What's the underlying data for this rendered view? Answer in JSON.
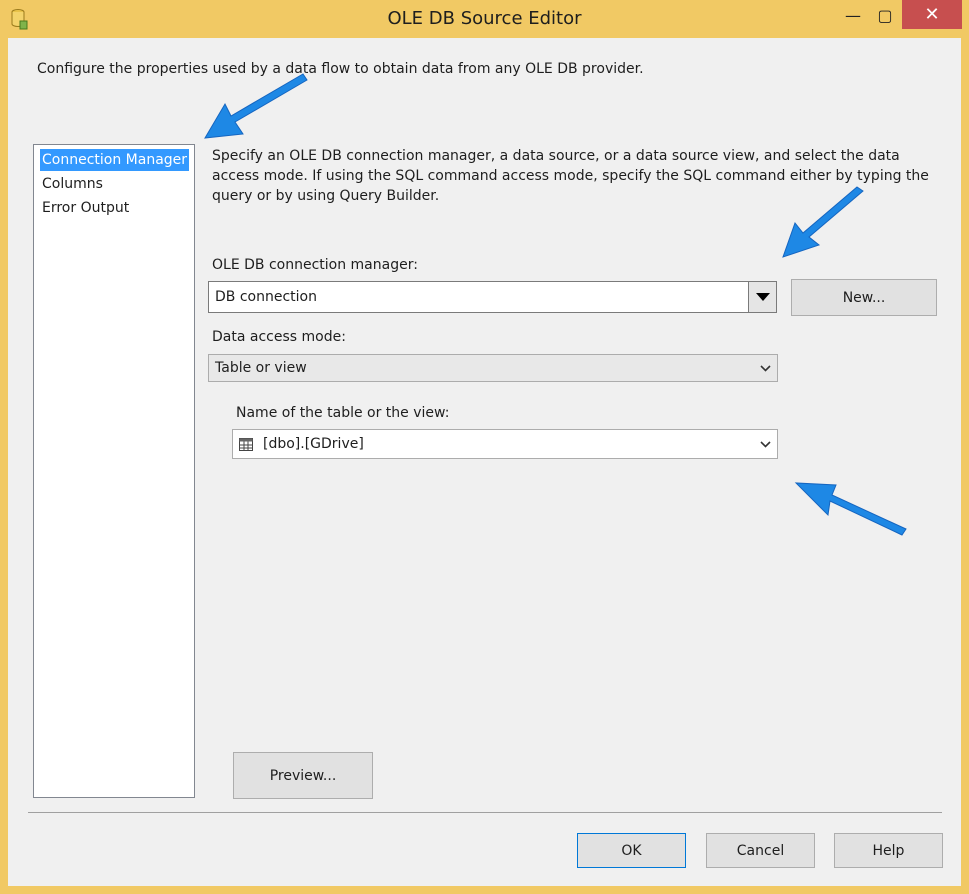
{
  "window": {
    "title": "OLE DB Source Editor"
  },
  "window_controls": {
    "minimize": "—",
    "maximize": "▢",
    "close": "✕"
  },
  "description": "Configure the properties used by a data flow to obtain data from any OLE DB provider.",
  "nav": {
    "items": [
      {
        "label": "Connection Manager",
        "selected": true
      },
      {
        "label": "Columns",
        "selected": false
      },
      {
        "label": "Error Output",
        "selected": false
      }
    ]
  },
  "info_text": "Specify an OLE DB connection manager, a data source, or a data source view, and select the data access mode. If using the SQL command access mode, specify the SQL command either by typing the query or by using Query Builder.",
  "connection": {
    "label": "OLE DB connection manager:",
    "value": "DB connection",
    "new_button": "New..."
  },
  "access_mode": {
    "label": "Data access mode:",
    "value": "Table or view"
  },
  "table": {
    "label": "Name of the table or the view:",
    "value": "[dbo].[GDrive]",
    "icon": "table-icon"
  },
  "preview_button": "Preview...",
  "footer": {
    "ok": "OK",
    "cancel": "Cancel",
    "help": "Help"
  },
  "colors": {
    "title_bar": "#f1c964",
    "selection": "#3399ff",
    "close_button": "#c74f4f",
    "annotation_arrow": "#1e88e5"
  }
}
